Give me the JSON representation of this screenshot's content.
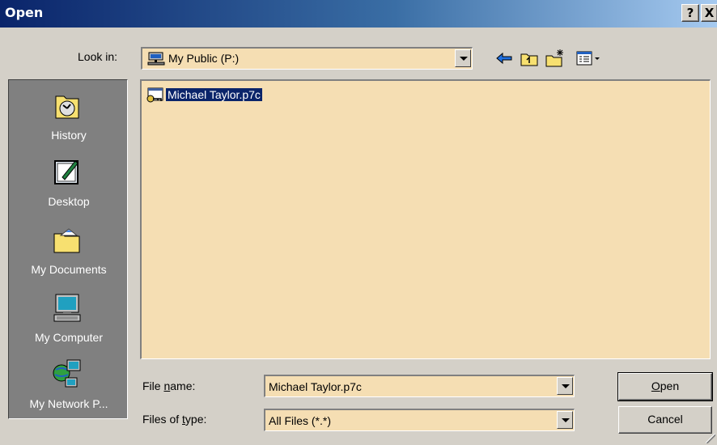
{
  "window": {
    "title": "Open",
    "help_label": "?",
    "close_label": "X"
  },
  "look_in": {
    "label": "Look in:",
    "value": "My Public (P:)"
  },
  "toolbar": {
    "icons": [
      "back-arrow-icon",
      "up-folder-icon",
      "new-folder-icon",
      "view-menu-icon"
    ]
  },
  "places": [
    {
      "label": "History",
      "icon": "history-icon"
    },
    {
      "label": "Desktop",
      "icon": "desktop-icon"
    },
    {
      "label": "My Documents",
      "icon": "my-documents-icon"
    },
    {
      "label": "My Computer",
      "icon": "my-computer-icon"
    },
    {
      "label": "My Network P...",
      "icon": "my-network-places-icon"
    }
  ],
  "files": [
    {
      "name": "Michael Taylor.p7c",
      "icon": "certificate-file-icon",
      "selected": true
    }
  ],
  "file_name": {
    "label": "File name:",
    "value": "Michael Taylor.p7c"
  },
  "file_type": {
    "label": "Files of type:",
    "value": "All Files (*.*)"
  },
  "buttons": {
    "open": "Open",
    "cancel": "Cancel"
  },
  "colors": {
    "title_start": "#0a246a",
    "title_end": "#a6caf0",
    "field_bg": "#f5deb3",
    "places_bg": "#808080",
    "selection": "#0a246a"
  }
}
